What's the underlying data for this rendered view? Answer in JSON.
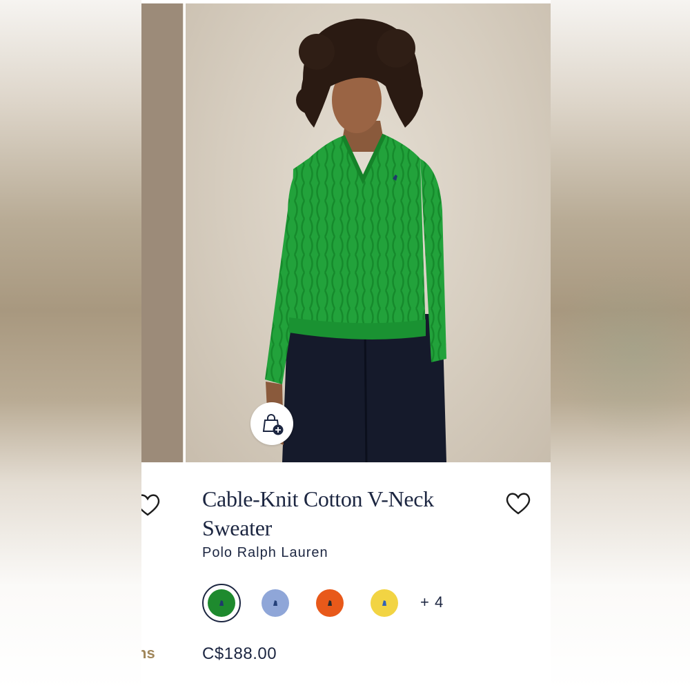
{
  "product": {
    "title": "Cable-Knit Cotton V-Neck Sweater",
    "brand": "Polo Ralph Lauren",
    "price": "C$188.00",
    "more_colors_label": "+ 4",
    "swatches": [
      {
        "name": "green",
        "color": "#1e8a2e",
        "pony_color": "#1f3a6b",
        "selected": true
      },
      {
        "name": "light-blue",
        "color": "#8fa6d8",
        "pony_color": "#24407a",
        "selected": false
      },
      {
        "name": "orange",
        "color": "#e8591a",
        "pony_color": "#2a2a2a",
        "selected": false
      },
      {
        "name": "yellow",
        "color": "#f2d443",
        "pony_color": "#3563b5",
        "selected": false
      }
    ]
  },
  "previous_card": {
    "partial_text": "ns"
  },
  "icons": {
    "add_to_bag": "shopping-bag-plus-icon",
    "wishlist": "heart-icon"
  },
  "colors": {
    "text_primary": "#1c2641",
    "sweater_green": "#21a33a",
    "accent_gold": "#a0865a"
  }
}
